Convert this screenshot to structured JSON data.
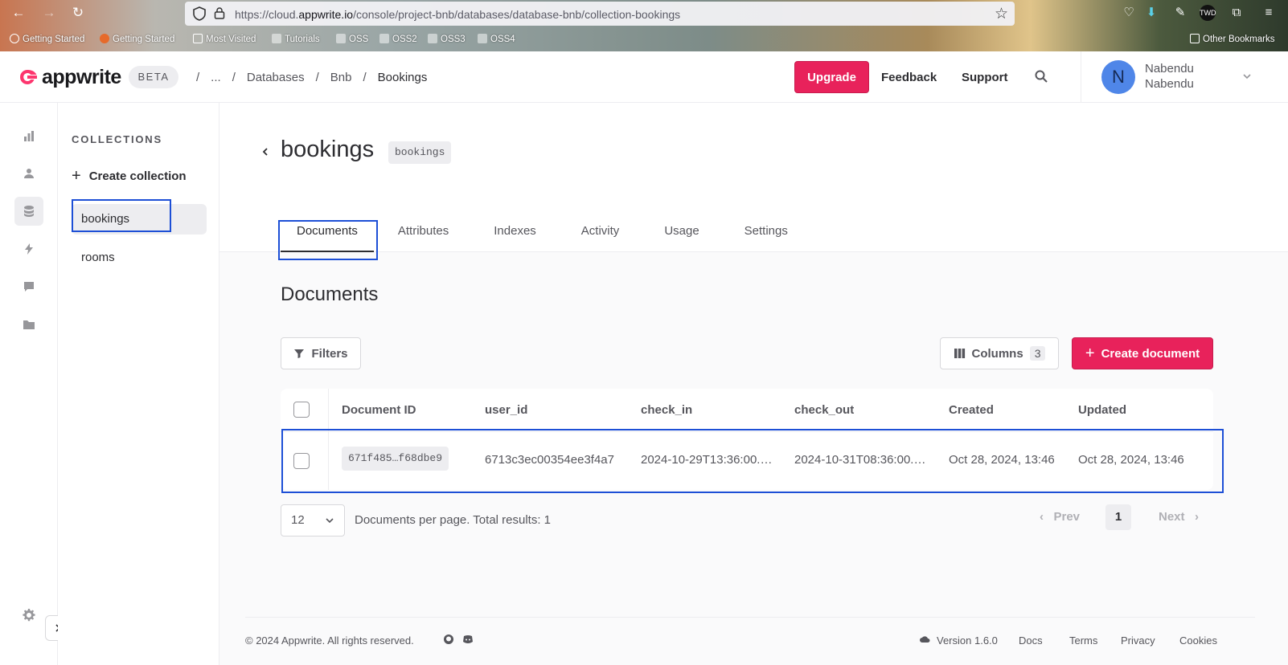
{
  "browser": {
    "url_prefix": "https://cloud.",
    "url_domain": "appwrite.io",
    "url_path": "/console/project-bnb/databases/database-bnb/collection-bookings",
    "bookmarks": [
      "Getting Started",
      "Getting Started",
      "Most Visited",
      "Tutorials",
      "OSS",
      "OSS2",
      "OSS3",
      "OSS4"
    ],
    "other_bookmarks": "Other Bookmarks"
  },
  "header": {
    "brand": "appwrite",
    "beta": "BETA",
    "breadcrumbs": [
      "...",
      "Databases",
      "Bnb",
      "Bookings"
    ],
    "upgrade": "Upgrade",
    "feedback": "Feedback",
    "support": "Support",
    "avatar_initial": "N",
    "user_name": "Nabendu",
    "user_org": "Nabendu"
  },
  "collections": {
    "title": "COLLECTIONS",
    "create_label": "Create collection",
    "items": [
      "bookings",
      "rooms"
    ]
  },
  "page": {
    "title": "bookings",
    "id_chip": "bookings",
    "tabs": [
      "Documents",
      "Attributes",
      "Indexes",
      "Activity",
      "Usage",
      "Settings"
    ],
    "section_title": "Documents",
    "filters": "Filters",
    "columns": "Columns",
    "columns_count": "3",
    "create_document": "Create document"
  },
  "table": {
    "headers": [
      "Document ID",
      "user_id",
      "check_in",
      "check_out",
      "Created",
      "Updated"
    ],
    "rows": [
      [
        "671f485…f68dbe9",
        "6713c3ec00354ee3f4a7",
        "2024-10-29T13:36:00.…",
        "2024-10-31T08:36:00.…",
        "Oct 28, 2024, 13:46",
        "Oct 28, 2024, 13:46"
      ]
    ]
  },
  "pagination": {
    "per_page": "12",
    "summary": "Documents per page. Total results: 1",
    "prev": "Prev",
    "current": "1",
    "next": "Next"
  },
  "footer": {
    "copyright": "© 2024 Appwrite. All rights reserved.",
    "version": "Version 1.6.0",
    "links": [
      "Docs",
      "Terms",
      "Privacy",
      "Cookies"
    ]
  },
  "colors": {
    "accent": "#e8225b",
    "highlight": "#1d4fd6"
  }
}
